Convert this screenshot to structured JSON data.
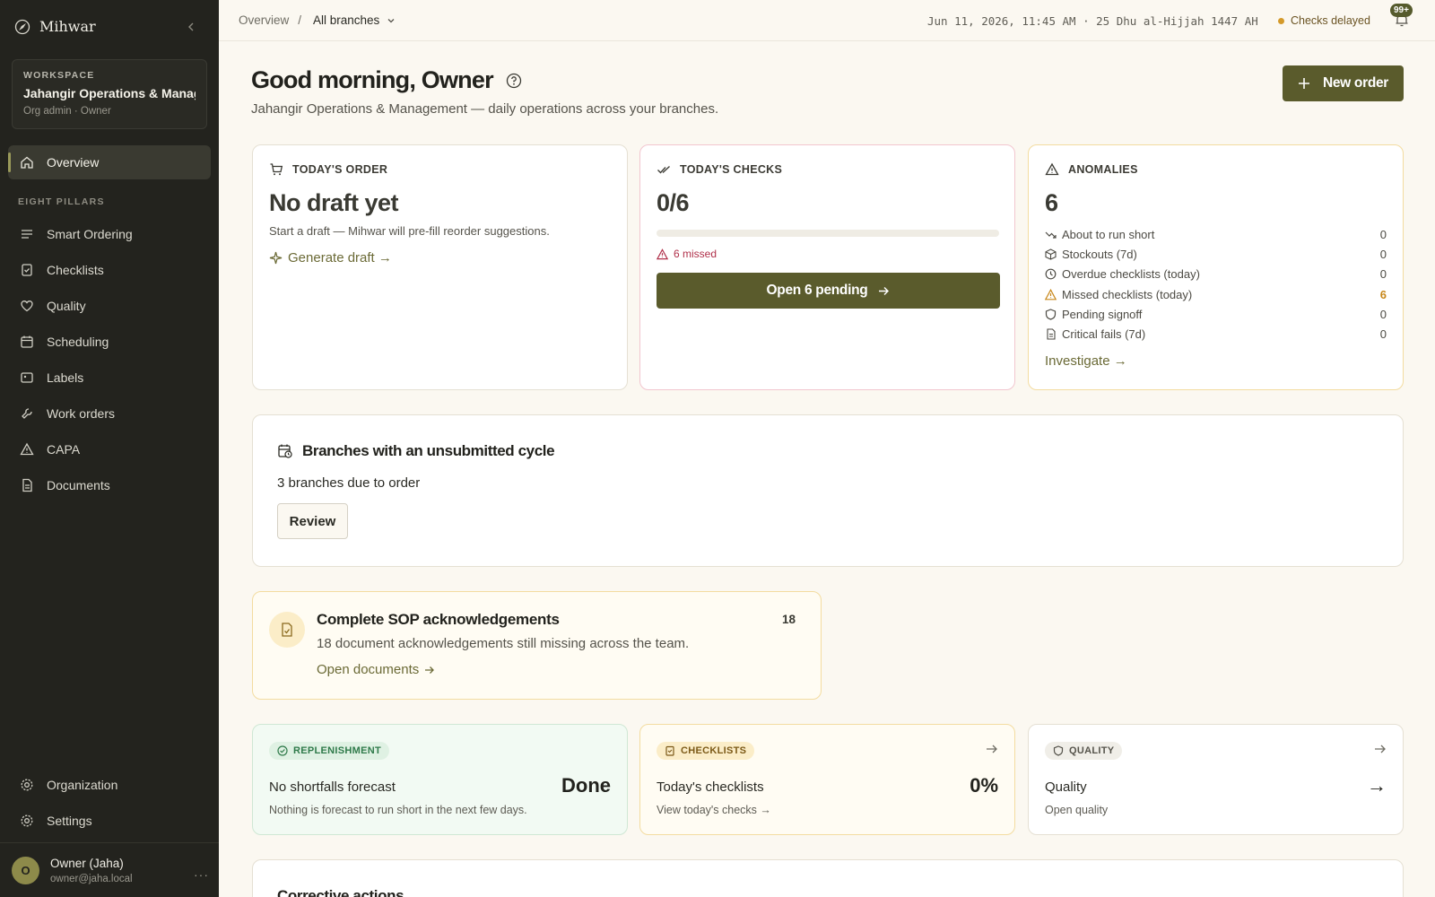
{
  "brand": {
    "name": "Mihwar"
  },
  "workspace": {
    "kicker": "WORKSPACE",
    "name": "Jahangir Operations & Manag...",
    "role": "Org admin · Owner"
  },
  "nav": {
    "active": "Overview",
    "section": "EIGHT PILLARS",
    "items": [
      "Smart Ordering",
      "Checklists",
      "Quality",
      "Scheduling",
      "Labels",
      "Work orders",
      "CAPA",
      "Documents"
    ],
    "bottom": [
      "Organization",
      "Settings"
    ]
  },
  "user": {
    "initial": "O",
    "name": "Owner (Jaha)",
    "email": "owner@jaha.local"
  },
  "topbar": {
    "crumb": "Overview",
    "separator": "/",
    "branch": "All branches",
    "datetime": "Jun 11, 2026, 11:45 AM · 25 Dhu al-Hijjah 1447 AH",
    "status": "Checks delayed",
    "badge": "99+"
  },
  "header": {
    "greeting": "Good morning, Owner",
    "subtitle": "Jahangir Operations & Management — daily operations across your branches.",
    "new_order": "New order"
  },
  "today_order": {
    "kicker": "TODAY'S ORDER",
    "title": "No draft yet",
    "desc": "Start a draft — Mihwar will pre-fill reorder suggestions.",
    "link": "Generate draft →"
  },
  "today_checks": {
    "kicker": "TODAY'S CHECKS",
    "value": "0/6",
    "progress": 0,
    "missed": "6 missed",
    "button": "Open 6 pending"
  },
  "anomalies": {
    "kicker": "ANOMALIES",
    "total": "6",
    "rows": [
      {
        "label": "About to run short",
        "value": "0",
        "icon": "trend-down-icon"
      },
      {
        "label": "Stockouts (7d)",
        "value": "0",
        "icon": "box-icon"
      },
      {
        "label": "Overdue checklists (today)",
        "value": "0",
        "icon": "clock-icon"
      },
      {
        "label": "Missed checklists (today)",
        "value": "6",
        "icon": "warning-icon"
      },
      {
        "label": "Pending signoff",
        "value": "0",
        "icon": "shield-icon"
      },
      {
        "label": "Critical fails (7d)",
        "value": "0",
        "icon": "document-icon"
      }
    ],
    "link": "Investigate →"
  },
  "branches": {
    "title": "Branches with an unsubmitted cycle",
    "desc": "3 branches due to order",
    "button": "Review"
  },
  "sop": {
    "title": "Complete SOP acknowledgements",
    "desc": "18 document acknowledgements still missing across the team.",
    "link": "Open documents",
    "count": "18"
  },
  "mini_cards": [
    {
      "pill": "REPLENISHMENT",
      "title": "No shortfalls forecast",
      "sub": "Nothing is forecast to run short in the next few days.",
      "value": "Done"
    },
    {
      "pill": "CHECKLISTS",
      "title": "Today's checklists",
      "sub": "View today's checks →",
      "value": "0%"
    },
    {
      "pill": "QUALITY",
      "title": "Quality",
      "sub": "Open quality",
      "value": "→"
    }
  ],
  "corrective": {
    "title": "Corrective actions"
  },
  "colors": {
    "accent": "#5a5b2c",
    "sidebar": "#23231e",
    "warning": "#c8881c",
    "danger": "#b0304a"
  }
}
